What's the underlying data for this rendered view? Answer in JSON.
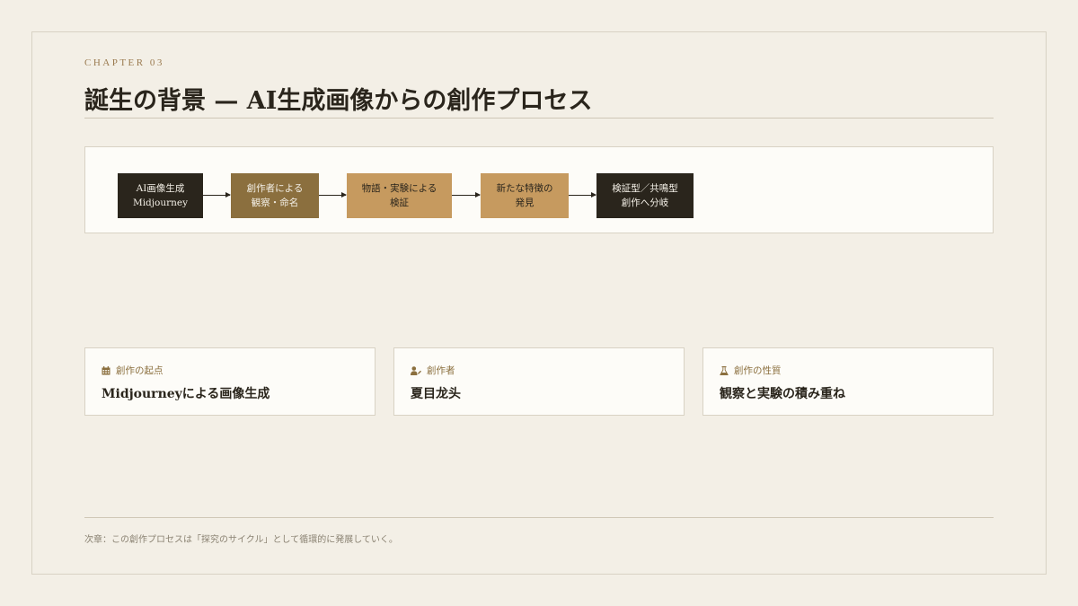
{
  "chapter": "CHAPTER 03",
  "title": "誕生の背景 — AI生成画像からの創作プロセス",
  "flow": {
    "nodes": [
      {
        "line1": "AI画像生成",
        "line2": "Midjourney"
      },
      {
        "line1": "創作者による",
        "line2": "観察・命名"
      },
      {
        "line1": "物語・実験による",
        "line2": "検証"
      },
      {
        "line1": "新たな特徴の",
        "line2": "発見"
      },
      {
        "line1": "検証型／共鳴型",
        "line2": "創作へ分岐"
      }
    ]
  },
  "cards": [
    {
      "icon": "calendar-icon",
      "label": "創作の起点",
      "value": "Midjourneyによる画像生成"
    },
    {
      "icon": "user-pen-icon",
      "label": "創作者",
      "value": "夏目龙头"
    },
    {
      "icon": "flask-icon",
      "label": "創作の性質",
      "value": "観察と実験の積み重ね"
    }
  ],
  "footer": "次章：この創作プロセスは「探究のサイクル」として循環的に発展していく。",
  "colors": {
    "background": "#f3efe6",
    "dark": "#2a251c",
    "brown": "#8b6f3e",
    "tan": "#c69a5f",
    "accent_text": "#9a7a4f"
  }
}
